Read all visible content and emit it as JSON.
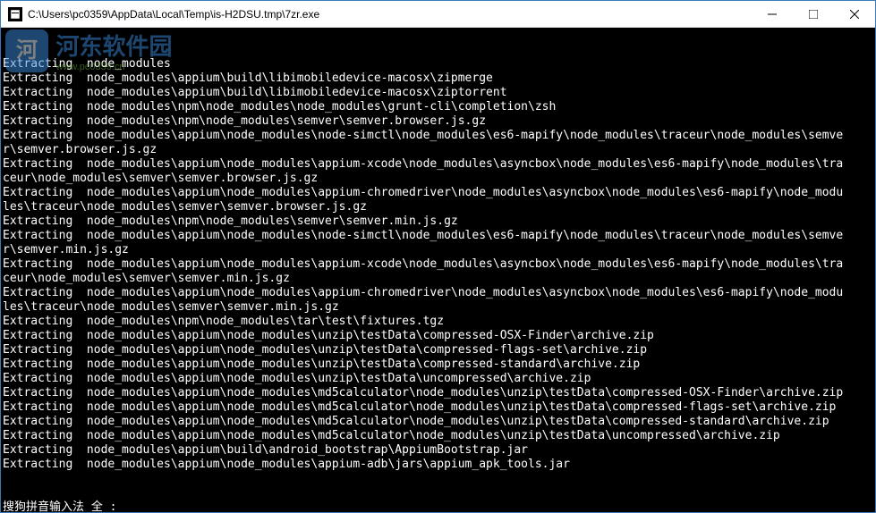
{
  "window": {
    "title": "C:\\Users\\pc0359\\AppData\\Local\\Temp\\is-H2DSU.tmp\\7zr.exe"
  },
  "watermark": {
    "logo_text": "河",
    "name": "河东软件园",
    "url": "www.pc0359.cn"
  },
  "terminal_lines": [
    "Extracting  node_modules",
    "Extracting  node_modules\\appium\\build\\libimobiledevice-macosx\\zipmerge",
    "Extracting  node_modules\\appium\\build\\libimobiledevice-macosx\\ziptorrent",
    "Extracting  node_modules\\npm\\node_modules\\node_modules\\grunt-cli\\completion\\zsh",
    "Extracting  node_modules\\npm\\node_modules\\semver\\semver.browser.js.gz",
    "Extracting  node_modules\\appium\\node_modules\\node-simctl\\node_modules\\es6-mapify\\node_modules\\traceur\\node_modules\\semve",
    "r\\semver.browser.js.gz",
    "Extracting  node_modules\\appium\\node_modules\\appium-xcode\\node_modules\\asyncbox\\node_modules\\es6-mapify\\node_modules\\tra",
    "ceur\\node_modules\\semver\\semver.browser.js.gz",
    "Extracting  node_modules\\appium\\node_modules\\appium-chromedriver\\node_modules\\asyncbox\\node_modules\\es6-mapify\\node_modu",
    "les\\traceur\\node_modules\\semver\\semver.browser.js.gz",
    "Extracting  node_modules\\npm\\node_modules\\semver\\semver.min.js.gz",
    "Extracting  node_modules\\appium\\node_modules\\node-simctl\\node_modules\\es6-mapify\\node_modules\\traceur\\node_modules\\semve",
    "r\\semver.min.js.gz",
    "Extracting  node_modules\\appium\\node_modules\\appium-xcode\\node_modules\\asyncbox\\node_modules\\es6-mapify\\node_modules\\tra",
    "ceur\\node_modules\\semver\\semver.min.js.gz",
    "Extracting  node_modules\\appium\\node_modules\\appium-chromedriver\\node_modules\\asyncbox\\node_modules\\es6-mapify\\node_modu",
    "les\\traceur\\node_modules\\semver\\semver.min.js.gz",
    "Extracting  node_modules\\npm\\node_modules\\tar\\test\\fixtures.tgz",
    "Extracting  node_modules\\appium\\node_modules\\unzip\\testData\\compressed-OSX-Finder\\archive.zip",
    "Extracting  node_modules\\appium\\node_modules\\unzip\\testData\\compressed-flags-set\\archive.zip",
    "Extracting  node_modules\\appium\\node_modules\\unzip\\testData\\compressed-standard\\archive.zip",
    "Extracting  node_modules\\appium\\node_modules\\unzip\\testData\\uncompressed\\archive.zip",
    "Extracting  node_modules\\appium\\node_modules\\md5calculator\\node_modules\\unzip\\testData\\compressed-OSX-Finder\\archive.zip",
    "",
    "Extracting  node_modules\\appium\\node_modules\\md5calculator\\node_modules\\unzip\\testData\\compressed-flags-set\\archive.zip",
    "Extracting  node_modules\\appium\\node_modules\\md5calculator\\node_modules\\unzip\\testData\\compressed-standard\\archive.zip",
    "Extracting  node_modules\\appium\\node_modules\\md5calculator\\node_modules\\unzip\\testData\\uncompressed\\archive.zip",
    "Extracting  node_modules\\appium\\build\\android_bootstrap\\AppiumBootstrap.jar",
    "Extracting  node_modules\\appium\\node_modules\\appium-adb\\jars\\appium_apk_tools.jar"
  ],
  "ime": {
    "text": "搜狗拼音输入法 全 :"
  }
}
